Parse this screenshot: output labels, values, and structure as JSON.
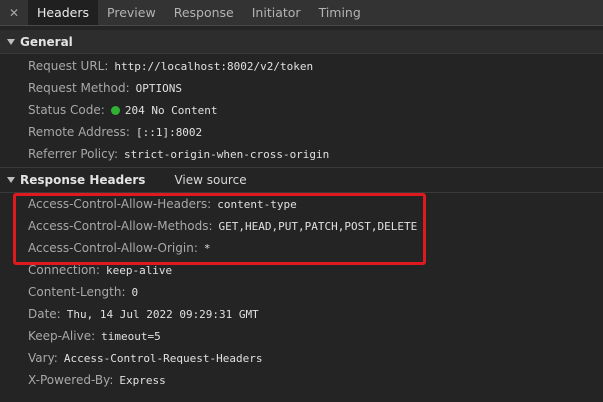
{
  "tabs": {
    "close_glyph": "✕",
    "items": [
      "Headers",
      "Preview",
      "Response",
      "Initiator",
      "Timing"
    ],
    "active": "Headers"
  },
  "general": {
    "title": "General",
    "rows": [
      {
        "name": "Request URL:",
        "value": "http://localhost:8002/v2/token"
      },
      {
        "name": "Request Method:",
        "value": "OPTIONS"
      },
      {
        "name": "Status Code:",
        "value": "204 No Content",
        "status_color": "#2fb134"
      },
      {
        "name": "Remote Address:",
        "value": "[::1]:8002"
      },
      {
        "name": "Referrer Policy:",
        "value": "strict-origin-when-cross-origin"
      }
    ]
  },
  "response_headers": {
    "title": "Response Headers",
    "view_source": "View source",
    "rows": [
      {
        "name": "Access-Control-Allow-Headers:",
        "value": "content-type"
      },
      {
        "name": "Access-Control-Allow-Methods:",
        "value": "GET,HEAD,PUT,PATCH,POST,DELETE"
      },
      {
        "name": "Access-Control-Allow-Origin:",
        "value": "*"
      },
      {
        "name": "Connection:",
        "value": "keep-alive"
      },
      {
        "name": "Content-Length:",
        "value": "0"
      },
      {
        "name": "Date:",
        "value": "Thu, 14 Jul 2022 09:29:31 GMT"
      },
      {
        "name": "Keep-Alive:",
        "value": "timeout=5"
      },
      {
        "name": "Vary:",
        "value": "Access-Control-Request-Headers"
      },
      {
        "name": "X-Powered-By:",
        "value": "Express"
      }
    ]
  },
  "colors": {
    "highlight": "#e0191f",
    "status_ok": "#2fb134"
  }
}
